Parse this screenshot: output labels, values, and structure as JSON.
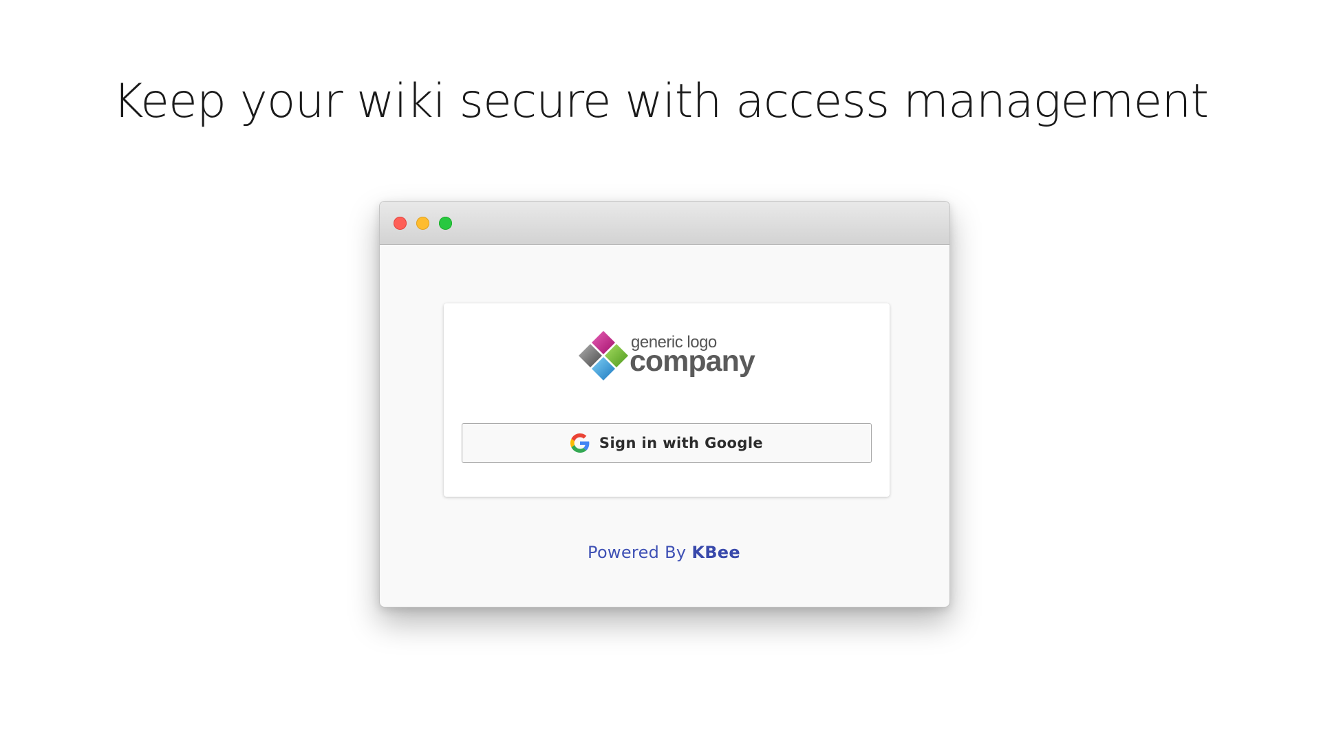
{
  "headline": "Keep your wiki secure with access management",
  "window": {
    "traffic_lights": {
      "close_color": "#fe5f57",
      "minimize_color": "#febc2e",
      "maximize_color": "#28c840"
    },
    "login_card": {
      "logo": {
        "tagline": "generic logo",
        "name": "company",
        "colors": [
          "#c2278a",
          "#7cb83a",
          "#2f9ed8",
          "#7a7a7a"
        ]
      },
      "sign_in_button": {
        "icon": "google-g-icon",
        "label": "Sign in with Google"
      }
    },
    "footer": {
      "prefix": "Powered By",
      "brand": "KBee",
      "color": "#3f51b5"
    }
  }
}
